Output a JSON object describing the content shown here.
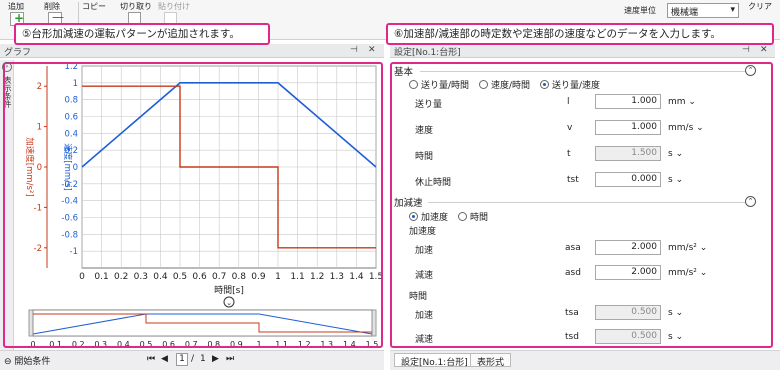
{
  "ribbon": {
    "add": "追加",
    "delete": "削除",
    "copy": "コピー",
    "cut": "切り取り",
    "paste": "貼り付け",
    "speed_unit_label": "速度単位",
    "speed_unit_value": "機械端",
    "clear": "クリア"
  },
  "callouts": {
    "left": "⑤台形加減速の運転パターンが追加されます。",
    "right": "⑥加速部/減速部の時定数や定速部の速度などのデータを入力します。"
  },
  "graph": {
    "title": "グラフ",
    "side_label": "表示条件",
    "start_condition": "開始条件",
    "page_current": "1",
    "page_sep": "/",
    "page_total": "1"
  },
  "settings": {
    "title": "設定[No.1:台形]",
    "tab_settings": "設定[No.1:台形]",
    "tab_table": "表形式",
    "basic": {
      "heading": "基本",
      "radio1": "送り量/時間",
      "radio2": "速度/時間",
      "radio3": "送り量/速度",
      "feed_label": "送り量",
      "feed_sym": "l",
      "feed_val": "1.000",
      "feed_unit": "mm",
      "speed_label": "速度",
      "speed_sym": "v",
      "speed_val": "1.000",
      "speed_unit": "mm/s",
      "time_label": "時間",
      "time_sym": "t",
      "time_val": "1.500",
      "time_unit": "s",
      "pause_label": "休止時間",
      "pause_sym": "tst",
      "pause_val": "0.000",
      "pause_unit": "s"
    },
    "accel": {
      "heading": "加減速",
      "radio1": "加速度",
      "radio2": "時間",
      "sub1": "加速度",
      "acc_label": "加速",
      "acc_sym": "asa",
      "acc_val": "2.000",
      "acc_unit": "mm/s²",
      "dec_label": "減速",
      "dec_sym": "asd",
      "dec_val": "2.000",
      "dec_unit": "mm/s²",
      "sub2": "時間",
      "tacc_label": "加速",
      "tacc_sym": "tsa",
      "tacc_val": "0.500",
      "tacc_unit": "s",
      "tdec_label": "減速",
      "tdec_sym": "tsd",
      "tdec_val": "0.500",
      "tdec_unit": "s"
    }
  },
  "colors": {
    "speed": "#1f5fd6",
    "accel": "#c8381a",
    "highlight": "#e0288c"
  },
  "chart_data": {
    "type": "line",
    "x": [
      0,
      0.1,
      0.2,
      0.3,
      0.4,
      0.5,
      0.6,
      0.7,
      0.8,
      0.9,
      1,
      1.1,
      1.2,
      1.3,
      1.4,
      1.5
    ],
    "xlabel": "時間[s]",
    "xlim": [
      0,
      1.5
    ],
    "ylabel_left": "加速度[mm/s²]",
    "ylim_left": [
      -2.5,
      2.5
    ],
    "yticks_left": [
      2,
      1,
      0,
      -1,
      -2
    ],
    "ylabel_right": "速度[mm/s]",
    "ylim_right": [
      -1.2,
      1.2
    ],
    "yticks_right": [
      1.2,
      1,
      0.8,
      0.6,
      0.4,
      0.2,
      0,
      -0.2,
      -0.4,
      -0.6,
      -0.8,
      -1
    ],
    "series": [
      {
        "name": "速度[mm/s]",
        "points": [
          [
            0,
            0
          ],
          [
            0.5,
            1
          ],
          [
            1,
            1
          ],
          [
            1.5,
            0
          ]
        ]
      },
      {
        "name": "加速度[mm/s²]",
        "points": [
          [
            0,
            2
          ],
          [
            0.5,
            2
          ],
          [
            0.5,
            0
          ],
          [
            1,
            0
          ],
          [
            1,
            -2
          ],
          [
            1.5,
            -2
          ]
        ]
      }
    ]
  }
}
